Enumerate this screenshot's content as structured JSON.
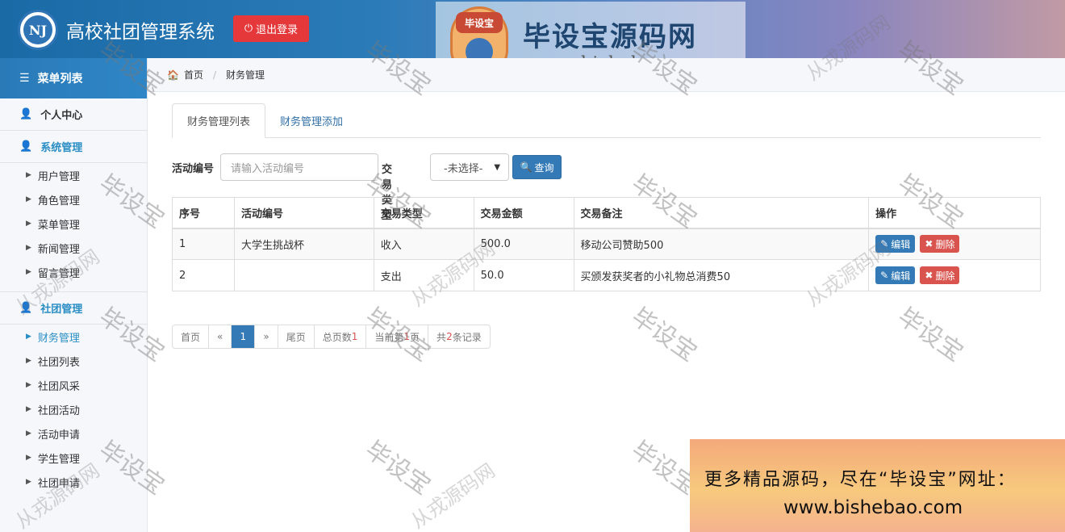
{
  "header": {
    "title": "高校社团管理系统",
    "logo_text": "NJ",
    "logout_label": "退出登录"
  },
  "brand": {
    "mascot_text": "毕设宝",
    "name": "毕设宝源码网",
    "url": "www.bishebao.com"
  },
  "sidebar": {
    "menu_title": "菜单列表",
    "personal": "个人中心",
    "system": {
      "label": "系统管理",
      "items": [
        "用户管理",
        "角色管理",
        "菜单管理",
        "新闻管理",
        "留言管理"
      ]
    },
    "club": {
      "label": "社团管理",
      "items": [
        "财务管理",
        "社团列表",
        "社团风采",
        "社团活动",
        "活动申请",
        "学生管理",
        "社团申请"
      ]
    }
  },
  "breadcrumb": {
    "home": "首页",
    "current": "财务管理"
  },
  "tabs": {
    "list": "财务管理列表",
    "add": "财务管理添加"
  },
  "search": {
    "activity_label": "活动编号",
    "activity_placeholder": "请输入活动编号",
    "type_label": "交易类型",
    "type_selected": "-未选择-",
    "query_label": "查询"
  },
  "table": {
    "headers": [
      "序号",
      "活动编号",
      "交易类型",
      "交易金额",
      "交易备注",
      "操作"
    ],
    "rows": [
      {
        "no": "1",
        "activity": "大学生挑战杯",
        "type": "收入",
        "amount": "500.0",
        "remark": "移动公司赞助500"
      },
      {
        "no": "2",
        "activity": "",
        "type": "支出",
        "amount": "50.0",
        "remark": "买颁发获奖者的小礼物总消费50"
      }
    ],
    "edit_label": "编辑",
    "delete_label": "删除"
  },
  "pagination": {
    "first": "首页",
    "prev": "«",
    "page": "1",
    "next": "»",
    "last": "尾页",
    "total_pages_label": "总页数",
    "total_pages": "1",
    "current_prefix": "当前第",
    "current_page": "1",
    "current_suffix": "页",
    "total_records_prefix": "共",
    "total_records": "2",
    "total_records_suffix": "条记录"
  },
  "watermark": {
    "main": "毕设宝",
    "alt": "从戎源码网"
  },
  "promo": {
    "line1": "更多精品源码，尽在“毕设宝”网址：",
    "line2": "www.bishebao.com"
  },
  "colors": {
    "primary": "#337ab7",
    "danger": "#d9534f",
    "accent": "#2a8ec5",
    "logout": "#e5383b"
  }
}
